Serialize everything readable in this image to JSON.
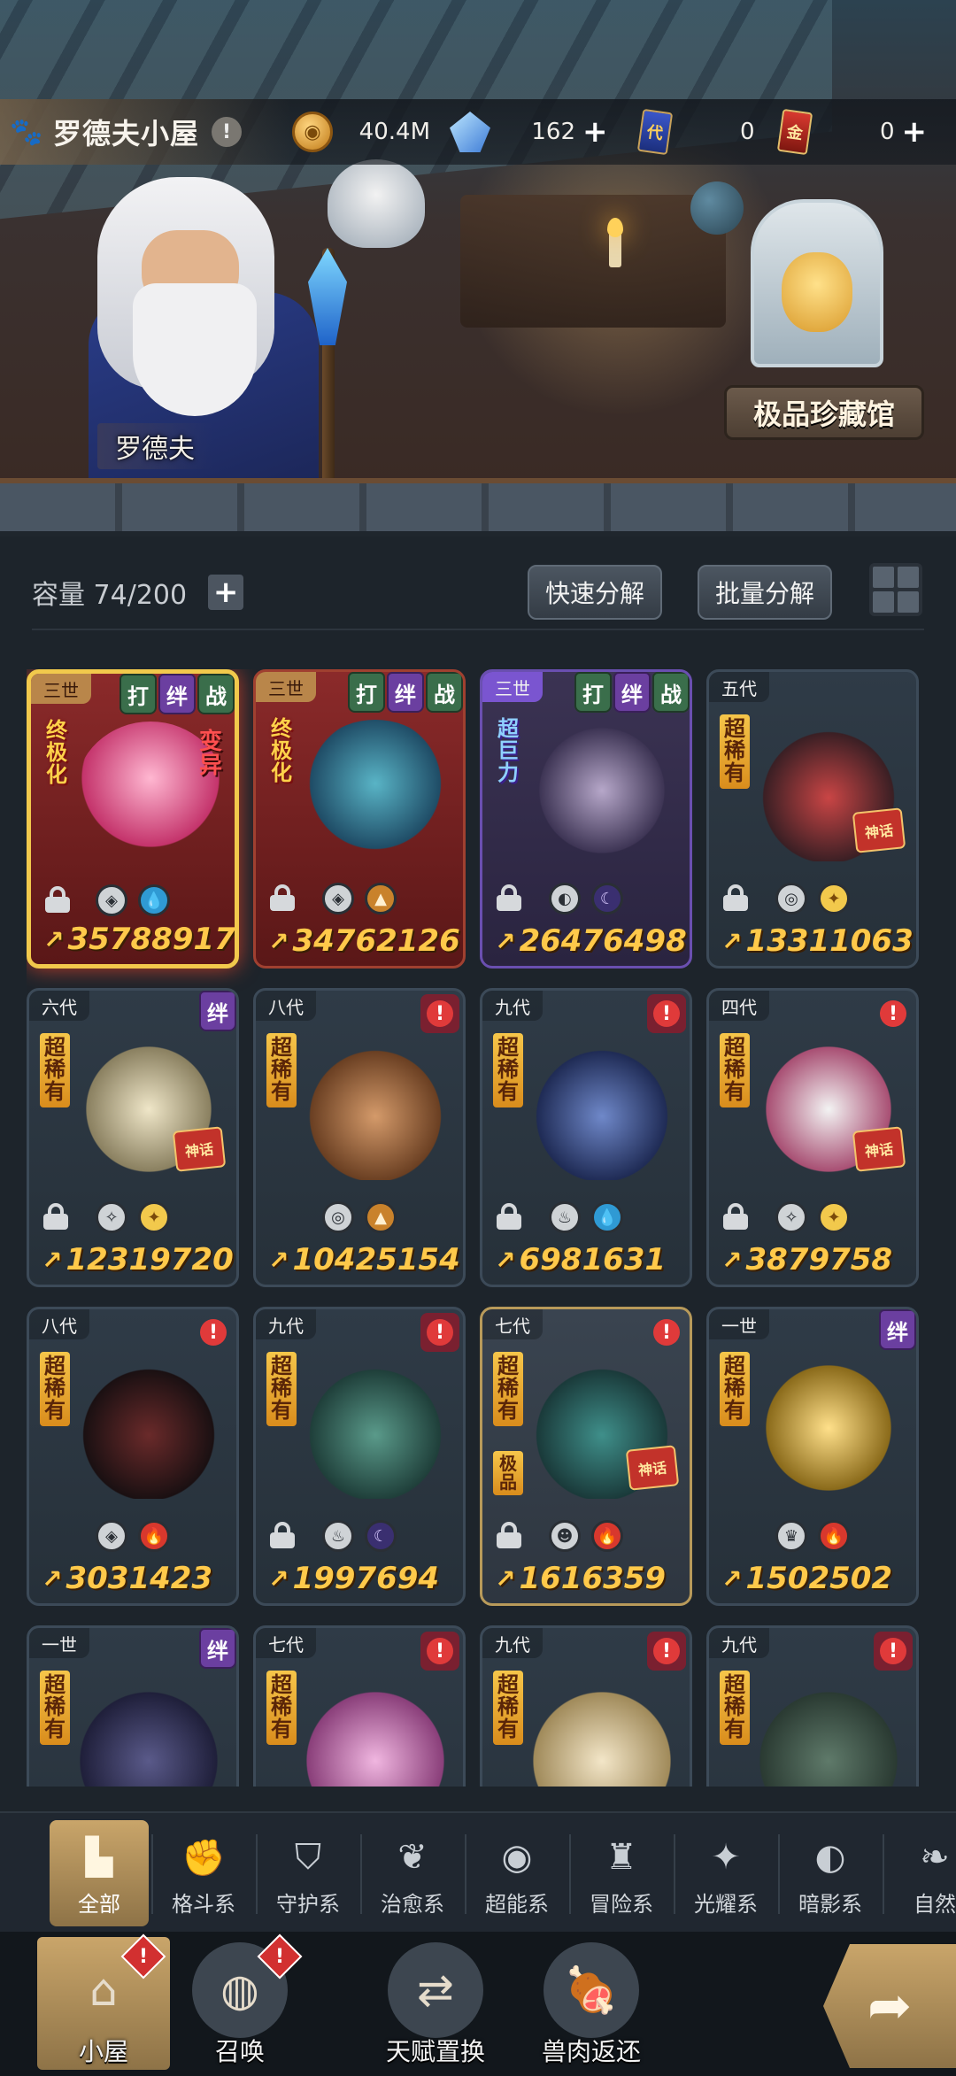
{
  "header": {
    "location_title": "罗德夫小屋",
    "info_icon": "exclamation-icon",
    "resources": [
      {
        "name": "gold",
        "icon": "coin-icon",
        "glyph": "◉",
        "value": "40.4M",
        "plus": ""
      },
      {
        "name": "diamond",
        "icon": "crystal-icon",
        "glyph": "",
        "value": "162",
        "plus": "+"
      },
      {
        "name": "generation-ticket",
        "icon": "ticket-blue-icon",
        "glyph": "代",
        "value": "0",
        "plus": ""
      },
      {
        "name": "gold-ticket",
        "icon": "ticket-red-icon",
        "glyph": "金",
        "value": "0",
        "plus": "+"
      }
    ]
  },
  "scene": {
    "npc_name": "罗德夫",
    "museum_label": "极品珍藏馆"
  },
  "inventory": {
    "capacity_text": "容量 74/200",
    "add_label": "+",
    "quick_decompose": "快速分解",
    "batch_decompose": "批量分解",
    "cards": [
      {
        "gen": "三世",
        "style": "red selected",
        "tags": [
          "打",
          "绊",
          "战"
        ],
        "alert": false,
        "rarity": "终极化",
        "rarity_style": "red",
        "mutate": "变异",
        "myth": "",
        "locked": true,
        "types": [
          {
            "cls": "",
            "g": "◈"
          },
          {
            "cls": "water",
            "g": "💧"
          }
        ],
        "power": "35788917",
        "art": "radial-gradient(circle at 50% 40%, #ffb7d1, #c4336b 60%, transparent 61%)"
      },
      {
        "gen": "三世",
        "style": "red",
        "tags": [
          "打",
          "绊",
          "战"
        ],
        "alert": false,
        "rarity": "终极化",
        "rarity_style": "red",
        "mutate": "",
        "myth": "",
        "locked": true,
        "types": [
          {
            "cls": "",
            "g": "◈"
          },
          {
            "cls": "earth",
            "g": "▲"
          }
        ],
        "power": "34762126",
        "art": "radial-gradient(circle at 50% 45%, #59b4c6, #1f4c66 60%, transparent 61%)"
      },
      {
        "gen": "三世",
        "style": "purple",
        "tags": [
          "打",
          "绊",
          "战"
        ],
        "alert": false,
        "rarity": "超巨力",
        "rarity_style": "purple",
        "mutate": "",
        "myth": "",
        "locked": true,
        "types": [
          {
            "cls": "",
            "g": "◐"
          },
          {
            "cls": "dark",
            "g": "☾"
          }
        ],
        "power": "26476498",
        "art": "radial-gradient(circle at 50% 50%, #b6a7c9, #3e3555 60%, transparent 61%)"
      },
      {
        "gen": "五代",
        "style": "",
        "tags": [],
        "alert": false,
        "rarity": "超稀有",
        "rarity_style": "",
        "mutate": "",
        "myth": "神话",
        "locked": true,
        "types": [
          {
            "cls": "",
            "g": "◎"
          },
          {
            "cls": "light",
            "g": "✦"
          }
        ],
        "power": "13311063",
        "art": "radial-gradient(circle at 50% 55%, #c94545, #3a1f24 60%, transparent 61%)"
      },
      {
        "gen": "六代",
        "style": "",
        "tags": [
          "绊"
        ],
        "alert": false,
        "rarity": "超稀有",
        "rarity_style": "",
        "mutate": "",
        "myth": "神话",
        "locked": true,
        "types": [
          {
            "cls": "",
            "g": "✧"
          },
          {
            "cls": "light",
            "g": "✦"
          }
        ],
        "power": "12319720",
        "art": "radial-gradient(circle at 50% 50%, #efe6c8, #8a8060 60%, transparent 61%)"
      },
      {
        "gen": "八代",
        "style": "",
        "tags": [],
        "alert": true,
        "rarity": "超稀有",
        "rarity_style": "",
        "mutate": "",
        "myth": "",
        "locked": false,
        "types": [
          {
            "cls": "",
            "g": "◎"
          },
          {
            "cls": "earth",
            "g": "▲"
          }
        ],
        "power": "10425154",
        "art": "radial-gradient(circle at 50% 55%, #d49a6a, #6a3f22 60%, transparent 61%)"
      },
      {
        "gen": "九代",
        "style": "",
        "tags": [],
        "alert": true,
        "rarity": "超稀有",
        "rarity_style": "",
        "mutate": "",
        "myth": "",
        "locked": true,
        "types": [
          {
            "cls": "",
            "g": "♨"
          },
          {
            "cls": "water",
            "g": "💧"
          }
        ],
        "power": "6981631",
        "art": "radial-gradient(circle at 50% 55%, #6f88c9, #1f2b55 60%, transparent 61%)"
      },
      {
        "gen": "四代",
        "style": "",
        "tags": [],
        "alert": true,
        "rarity": "超稀有",
        "rarity_style": "",
        "mutate": "",
        "myth": "神话",
        "locked": true,
        "types": [
          {
            "cls": "",
            "g": "✧"
          },
          {
            "cls": "light",
            "g": "✦"
          }
        ],
        "power": "3879758",
        "art": "radial-gradient(circle at 50% 50%, #f3f3f3, #a84f73 60%, transparent 61%)"
      },
      {
        "gen": "八代",
        "style": "",
        "tags": [],
        "alert": true,
        "rarity": "超稀有",
        "rarity_style": "",
        "mutate": "",
        "myth": "",
        "locked": false,
        "types": [
          {
            "cls": "",
            "g": "◈"
          },
          {
            "cls": "fire",
            "g": "🔥"
          }
        ],
        "power": "3031423",
        "art": "radial-gradient(circle at 50% 55%, #6a2a2a, #1a1012 60%, transparent 61%)"
      },
      {
        "gen": "九代",
        "style": "",
        "tags": [],
        "alert": true,
        "rarity": "超稀有",
        "rarity_style": "",
        "mutate": "",
        "myth": "",
        "locked": true,
        "types": [
          {
            "cls": "",
            "g": "♨"
          },
          {
            "cls": "dark",
            "g": "☾"
          }
        ],
        "power": "1997694",
        "art": "radial-gradient(circle at 50% 55%, #5a9a8a, #1f3f3a 60%, transparent 61%)"
      },
      {
        "gen": "七代",
        "style": "golden",
        "tags": [],
        "alert": true,
        "rarity": "超稀有",
        "rarity_style": "",
        "mutate": "",
        "myth": "神话",
        "extra_rarity": "极品",
        "locked": true,
        "types": [
          {
            "cls": "",
            "g": "☻"
          },
          {
            "cls": "fire",
            "g": "🔥"
          }
        ],
        "power": "1616359",
        "art": "radial-gradient(circle at 50% 55%, #3f8f8a, #1a3a3a 60%, transparent 61%)"
      },
      {
        "gen": "一世",
        "style": "",
        "tags": [
          "绊"
        ],
        "alert": false,
        "rarity": "超稀有",
        "rarity_style": "",
        "mutate": "",
        "myth": "",
        "locked": false,
        "types": [
          {
            "cls": "",
            "g": "♛"
          },
          {
            "cls": "fire",
            "g": "🔥"
          }
        ],
        "power": "1502502",
        "art": "radial-gradient(circle at 50% 50%, #ffe08a, #8a6a1a 60%, transparent 61%)"
      },
      {
        "gen": "一世",
        "style": "",
        "tags": [
          "绊"
        ],
        "alert": false,
        "rarity": "超稀有",
        "rarity_style": "",
        "mutate": "",
        "myth": "",
        "locked": false,
        "types": [],
        "power": "",
        "art": "radial-gradient(circle at 50% 60%, #5a5a8a, #1f1f3a 60%, transparent 61%)"
      },
      {
        "gen": "七代",
        "style": "",
        "tags": [],
        "alert": true,
        "rarity": "超稀有",
        "rarity_style": "",
        "mutate": "",
        "myth": "",
        "locked": false,
        "types": [],
        "power": "",
        "art": "radial-gradient(circle at 50% 60%, #f0b6e0, #8a3f7a 60%, transparent 61%)"
      },
      {
        "gen": "九代",
        "style": "",
        "tags": [],
        "alert": true,
        "rarity": "超稀有",
        "rarity_style": "",
        "mutate": "",
        "myth": "",
        "locked": false,
        "types": [],
        "power": "",
        "art": "radial-gradient(circle at 50% 60%, #f3e6c8, #a08a5a 60%, transparent 61%)"
      },
      {
        "gen": "九代",
        "style": "",
        "tags": [],
        "alert": true,
        "rarity": "超稀有",
        "rarity_style": "",
        "mutate": "",
        "myth": "",
        "locked": false,
        "types": [],
        "power": "",
        "art": "radial-gradient(circle at 50% 60%, #5f7a6a, #2a3a32 60%, transparent 61%)"
      }
    ]
  },
  "filters": [
    {
      "label": "全部",
      "icon": "all-blocks-icon",
      "glyph": "▙",
      "active": true
    },
    {
      "label": "格斗系",
      "icon": "fist-icon",
      "glyph": "✊",
      "active": false
    },
    {
      "label": "守护系",
      "icon": "shield-icon",
      "glyph": "⛉",
      "active": false
    },
    {
      "label": "治愈系",
      "icon": "sprout-icon",
      "glyph": "❦",
      "active": false
    },
    {
      "label": "超能系",
      "icon": "alien-icon",
      "glyph": "◉",
      "active": false
    },
    {
      "label": "冒险系",
      "icon": "tower-icon",
      "glyph": "♜",
      "active": false
    },
    {
      "label": "光耀系",
      "icon": "star-burst-icon",
      "glyph": "✦",
      "active": false
    },
    {
      "label": "暗影系",
      "icon": "eye-icon",
      "glyph": "◐",
      "active": false
    },
    {
      "label": "自然",
      "icon": "leaf-icon",
      "glyph": "❧",
      "active": false
    }
  ],
  "nav": [
    {
      "label": "小屋",
      "icon": "house-icon",
      "glyph": "⌂",
      "active": true,
      "badge": "!"
    },
    {
      "label": "召唤",
      "icon": "egg-icon",
      "glyph": "◍",
      "active": false,
      "badge": "!"
    },
    {
      "label": "天赋置换",
      "icon": "swap-arrows-icon",
      "glyph": "⇄",
      "active": false,
      "badge": ""
    },
    {
      "label": "兽肉返还",
      "icon": "meat-icon",
      "glyph": "🍖",
      "active": false,
      "badge": ""
    }
  ],
  "go_button_glyph": "➦"
}
